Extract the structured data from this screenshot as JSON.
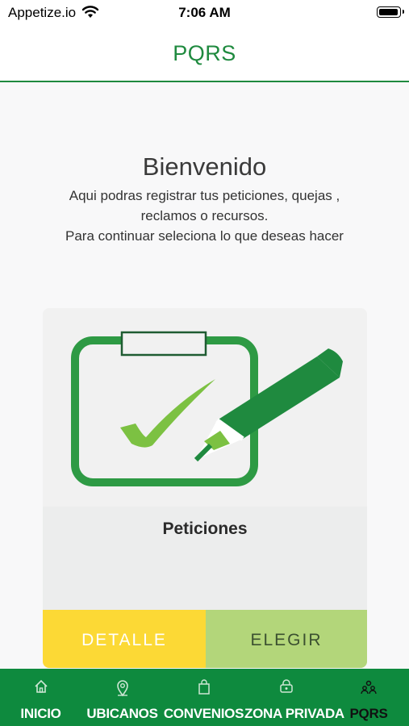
{
  "status_bar": {
    "carrier": "Appetize.io",
    "time": "7:06 AM"
  },
  "header": {
    "title": "PQRS"
  },
  "welcome": {
    "title": "Bienvenido",
    "line1": "Aqui podras registrar tus peticiones, quejas ,",
    "line2": "reclamos o recursos.",
    "line3": "Para continuar seleciona lo que deseas hacer"
  },
  "card": {
    "image_icon": "clipboard-check-pencil",
    "title": "Peticiones",
    "detail_label": "DETALLE",
    "choose_label": "ELEGIR"
  },
  "colors": {
    "brand_green": "#0e8a3e",
    "detail_yellow": "#fcd935",
    "choose_green": "#b3d67a"
  },
  "tab_bar": {
    "active": "PQRS",
    "items": [
      {
        "label": "INICIO",
        "icon": "home-icon"
      },
      {
        "label": "UBICANOS",
        "icon": "location-pin-icon"
      },
      {
        "label": "CONVENIOS",
        "icon": "shopping-bag-icon"
      },
      {
        "label": "ZONA PRIVADA",
        "icon": "lock-icon"
      },
      {
        "label": "PQRS",
        "icon": "people-icon"
      }
    ]
  }
}
